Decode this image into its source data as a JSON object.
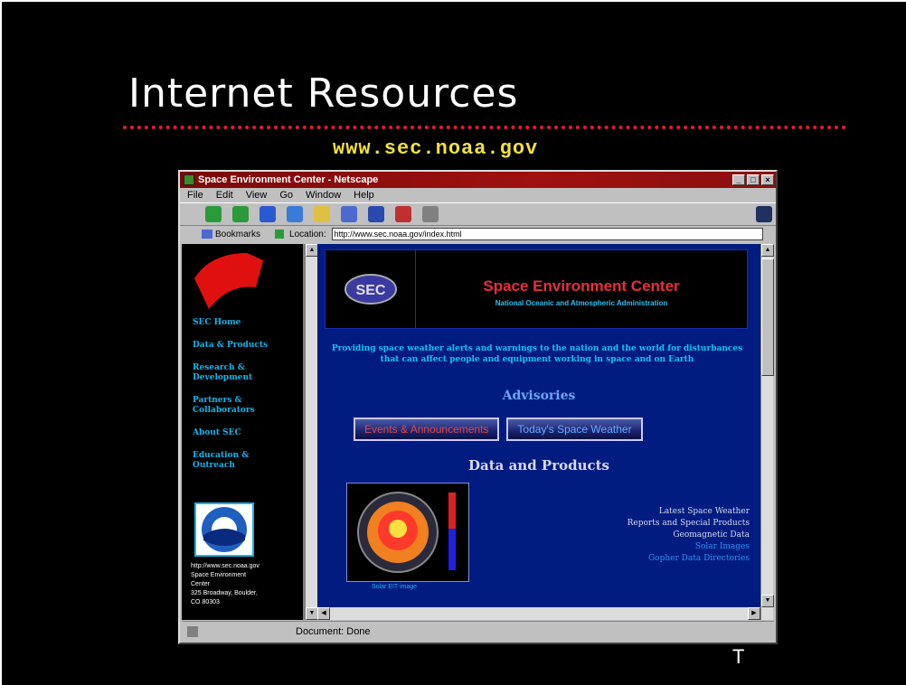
{
  "slide": {
    "title": "Internet Resources",
    "url_caption": "www.sec.noaa.gov",
    "footer_letter": "T"
  },
  "browser": {
    "window_title": "Space Environment Center - Netscape",
    "menu": [
      "File",
      "Edit",
      "View",
      "Go",
      "Window",
      "Help"
    ],
    "bookmarks_label": "Bookmarks",
    "location_label": "Location:",
    "location_value": "http://www.sec.noaa.gov/index.html",
    "status_text": "Document: Done"
  },
  "left_frame": {
    "nav": [
      "SEC Home",
      "Data & Products",
      "Research & Development",
      "Partners & Collaborators",
      "About SEC",
      "Education & Outreach"
    ],
    "address": [
      "http://www.sec.noaa.gov",
      "Space Environment",
      "Center",
      "325 Broadway, Boulder,",
      "CO 80303"
    ]
  },
  "page": {
    "banner_title": "Space Environment Center",
    "banner_subtitle": "National Oceanic and Atmospheric Administration",
    "tagline": "Providing space weather alerts and warnings to the nation and the world for disturbances that can affect people and equipment working in space and on Earth",
    "advisories_heading": "Advisories",
    "events_button": "Events & Announcements",
    "weather_button": "Today's Space Weather",
    "data_heading": "Data and Products",
    "image_caption": "Solar EIT image",
    "links": [
      "Latest Space Weather",
      "Reports and Special Products",
      "Geomagnetic Data",
      "Solar Images",
      "Gopher Data Directories"
    ]
  },
  "colors": {
    "slide_bg": "#000000",
    "rule": "#e0202a",
    "url_caption": "#f3e33b",
    "page_bg": "#001c80",
    "banner_title": "#e8303a"
  }
}
